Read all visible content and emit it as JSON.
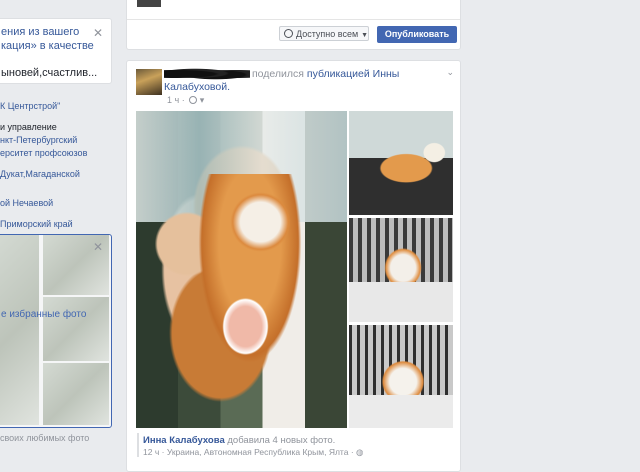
{
  "left_column": {
    "notice": {
      "line1": "ения из вашего",
      "line2": "кация» в качестве",
      "line3": "ыновей,счастлив..."
    },
    "intro": [
      "К Центрстрой\"",
      "и управление",
      "нкт-Петербургский",
      "ерситет профсоюзов",
      "Дукат,Магаданской",
      "",
      "ой Нечаевой",
      "Приморский край"
    ],
    "photos_card": {
      "add_label": "е избранные фото"
    },
    "photos_caption": "своих любимых фото"
  },
  "composer": {
    "audience_label": "Доступно всем",
    "publish_label": "Опубликовать"
  },
  "post": {
    "shared_text": "поделился",
    "shared_link": "публикацией Инны Калабуховой.",
    "time": "1 ч",
    "attribution": {
      "author": "Инна Калабухова",
      "action": "добавила 4 новых фото.",
      "time": "12 ч",
      "location": "Украина, Автономная Республика Крым, Ялта"
    }
  },
  "icons": {
    "close": "close-icon",
    "globe": "globe-icon",
    "chevron": "chevron-down-icon"
  },
  "colors": {
    "brand_blue": "#4267b2",
    "link_blue": "#365899",
    "page_bg": "#e9ebee",
    "muted_text": "#90949c"
  }
}
